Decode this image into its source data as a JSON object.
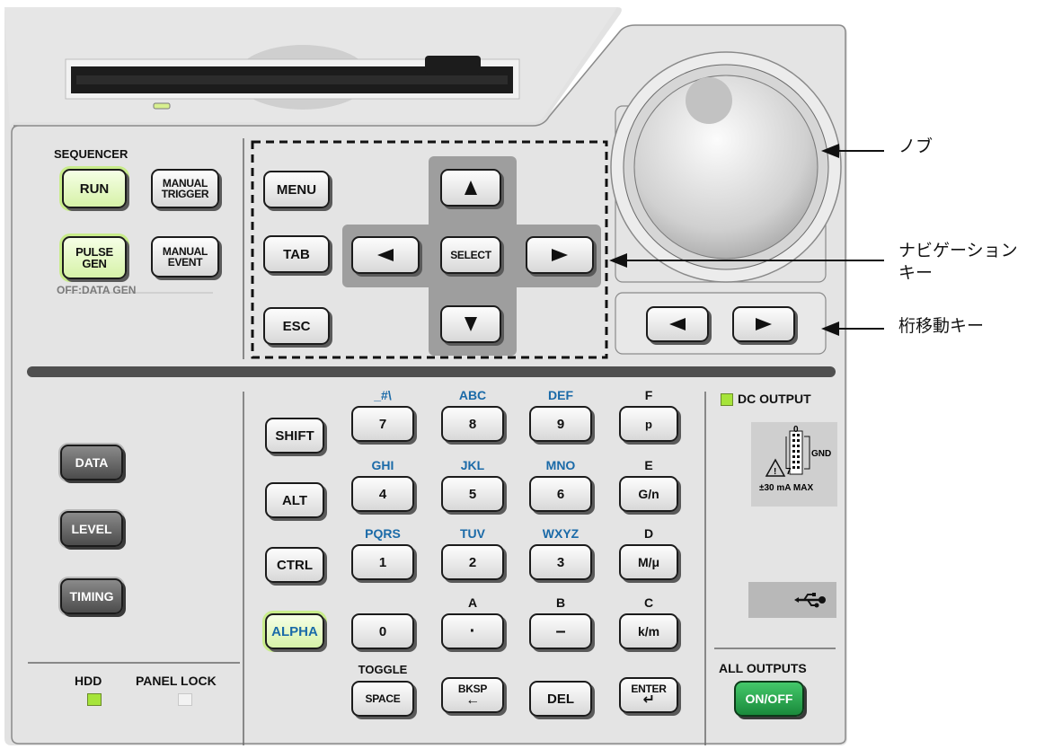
{
  "callouts": {
    "knob": "ノブ",
    "navigation_line1": "ナビゲーション",
    "navigation_line2": "キー",
    "digit_shift": "桁移動キー"
  },
  "sequencer": {
    "title": "SEQUENCER",
    "run": "RUN",
    "manual_trigger_1": "MANUAL",
    "manual_trigger_2": "TRIGGER",
    "pulse_gen_1": "PULSE",
    "pulse_gen_2": "GEN",
    "manual_event_1": "MANUAL",
    "manual_event_2": "EVENT",
    "off_data_gen": "OFF:DATA GEN"
  },
  "nav": {
    "menu": "MENU",
    "tab": "TAB",
    "esc": "ESC",
    "select": "SELECT"
  },
  "modes": {
    "data": "DATA",
    "level": "LEVEL",
    "timing": "TIMING"
  },
  "modifiers": {
    "shift": "SHIFT",
    "alt": "ALT",
    "ctrl": "CTRL",
    "alpha": "ALPHA"
  },
  "keypad": {
    "row1": [
      {
        "top": "_#\\",
        "key": "7"
      },
      {
        "top": "ABC",
        "key": "8"
      },
      {
        "top": "DEF",
        "key": "9"
      },
      {
        "top": "F",
        "key": "p"
      }
    ],
    "row2": [
      {
        "top": "GHI",
        "key": "4"
      },
      {
        "top": "JKL",
        "key": "5"
      },
      {
        "top": "MNO",
        "key": "6"
      },
      {
        "top": "E",
        "key": "G/n"
      }
    ],
    "row3": [
      {
        "top": "PQRS",
        "key": "1"
      },
      {
        "top": "TUV",
        "key": "2"
      },
      {
        "top": "WXYZ",
        "key": "3"
      },
      {
        "top": "D",
        "key": "M/μ"
      }
    ],
    "row4": [
      {
        "top": "",
        "key": "0"
      },
      {
        "top": "A",
        "key": "·"
      },
      {
        "top": "B",
        "key": "–"
      },
      {
        "top": "C",
        "key": "k/m"
      }
    ],
    "toggle": "TOGGLE",
    "space": "SPACE",
    "bksp": "BKSP",
    "del": "DEL",
    "enter": "ENTER"
  },
  "status": {
    "hdd": "HDD",
    "panel_lock": "PANEL LOCK"
  },
  "outputs": {
    "dc_output": "DC OUTPUT",
    "connector_zero": "0",
    "connector_seven": "7",
    "connector_gnd": "GND",
    "connector_rating": "±30 mA MAX",
    "all_outputs": "ALL OUTPUTS",
    "on_off": "ON/OFF"
  },
  "colors": {
    "panel": "#e3e3e3",
    "nav_cross": "#9e9e9e",
    "led_green": "#a6e43a",
    "led_off": "#f2f2f2",
    "label_blue": "#1a6aa8"
  },
  "icons": {
    "usb": "usb-icon",
    "warning": "warning-icon"
  }
}
